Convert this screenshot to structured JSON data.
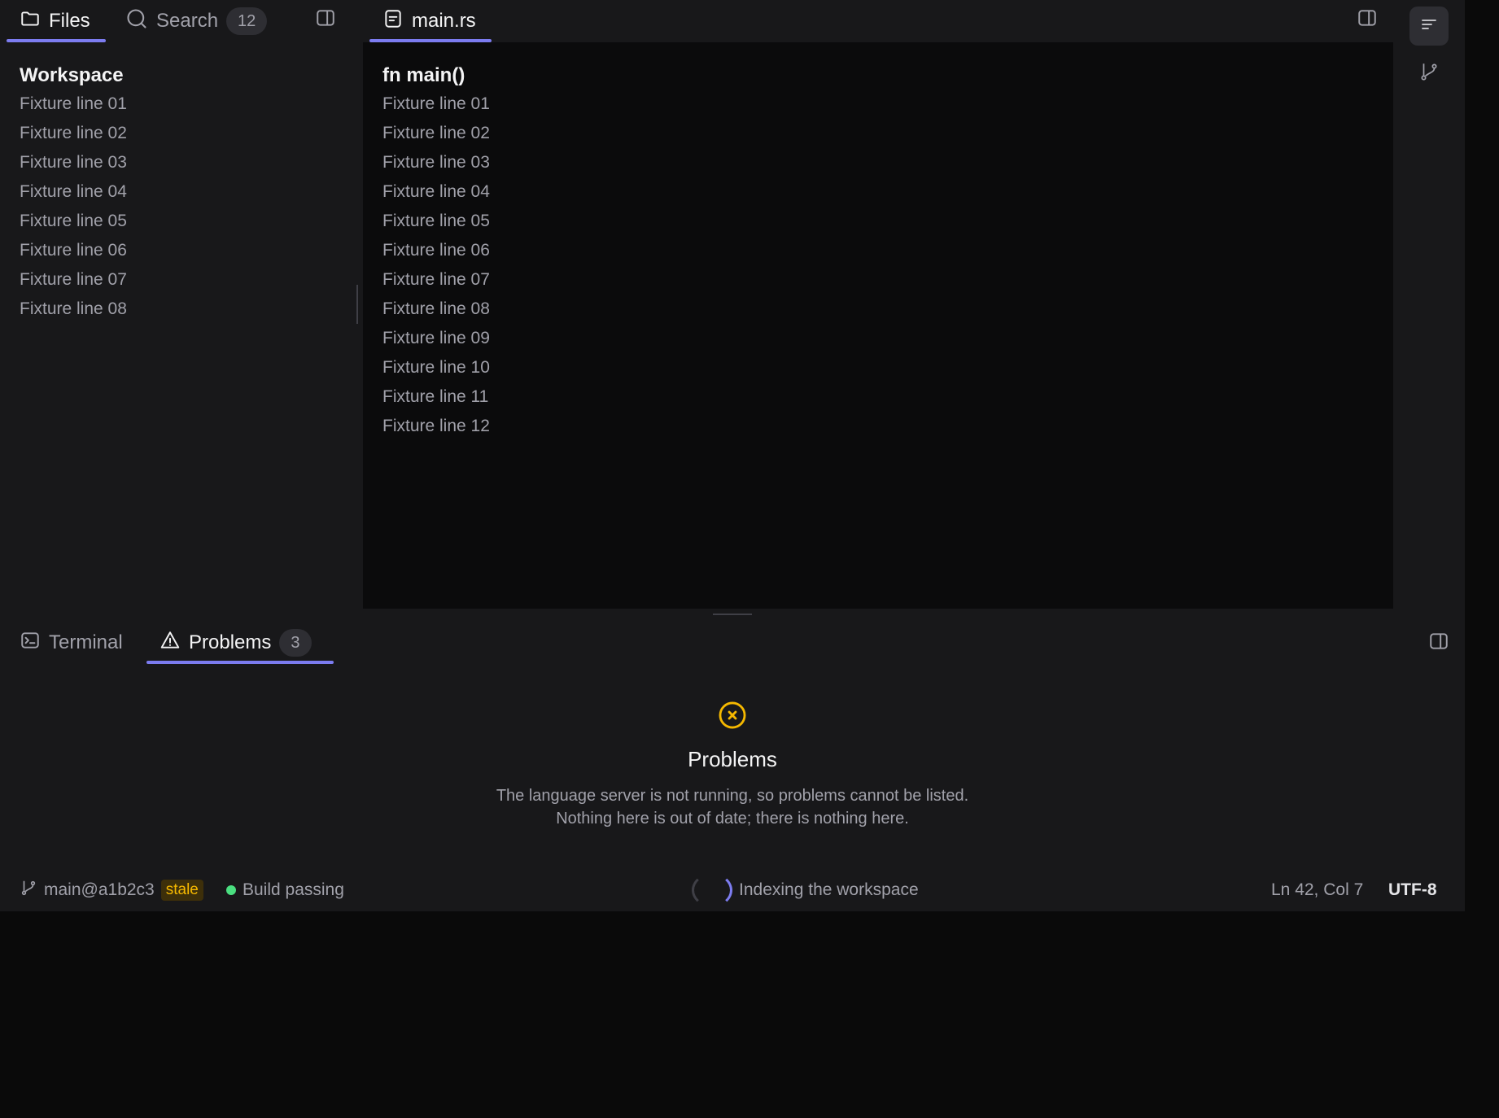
{
  "sidebar": {
    "tabs": [
      {
        "label": "Files",
        "icon": "folder-icon",
        "active": true
      },
      {
        "label": "Search",
        "icon": "search-icon",
        "count": "12",
        "active": false
      }
    ],
    "section_title": "Workspace",
    "items": [
      "Fixture line 01",
      "Fixture line 02",
      "Fixture line 03",
      "Fixture line 04",
      "Fixture line 05",
      "Fixture line 06",
      "Fixture line 07",
      "Fixture line 08"
    ]
  },
  "editor": {
    "tab_label": "main.rs",
    "heading": "fn main()",
    "lines": [
      "Fixture line 01",
      "Fixture line 02",
      "Fixture line 03",
      "Fixture line 04",
      "Fixture line 05",
      "Fixture line 06",
      "Fixture line 07",
      "Fixture line 08",
      "Fixture line 09",
      "Fixture line 10",
      "Fixture line 11",
      "Fixture line 12"
    ]
  },
  "panel": {
    "tabs": [
      {
        "label": "Terminal",
        "icon": "terminal-icon",
        "active": false
      },
      {
        "label": "Problems",
        "icon": "warning-icon",
        "count": "3",
        "active": true
      }
    ],
    "empty_title": "Problems",
    "empty_line1": "The language server is not running, so problems cannot be listed.",
    "empty_line2": "Nothing here is out of date; there is nothing here."
  },
  "status": {
    "branch": "main@a1b2c3",
    "stale": "stale",
    "build": "Build passing",
    "indexing": "Indexing the workspace",
    "position": "Ln 42, Col 7",
    "encoding": "UTF-8"
  },
  "colors": {
    "accent": "#7c7cf0",
    "warning": "#f5b800",
    "success": "#4ade80",
    "background": "#18181a",
    "editor_background": "#0b0b0c"
  }
}
